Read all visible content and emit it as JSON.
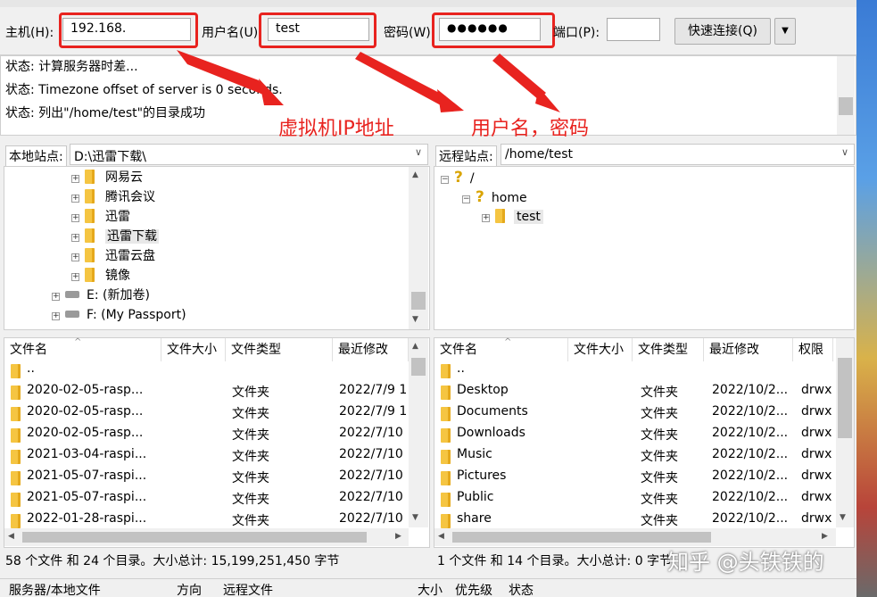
{
  "quickconnect": {
    "host_label": "主机(H):",
    "host_value": "192.168.",
    "user_label": "用户名(U):",
    "user_value": "test",
    "pass_label": "密码(W):",
    "pass_value": "●●●●●●",
    "port_label": "端口(P):",
    "port_value": "",
    "connect_label": "快速连接(Q)"
  },
  "log": [
    "状态: 计算服务器时差...",
    "状态: Timezone offset of server is 0 seconds.",
    "状态: 列出\"/home/test\"的目录成功"
  ],
  "annotations": {
    "vm_ip": "虚拟机IP地址",
    "user_pass": "用户名，密码"
  },
  "local": {
    "site_label": "本地站点:",
    "path": "D:\\迅雷下载\\",
    "tree": [
      "网易云",
      "腾讯会议",
      "迅雷",
      "迅雷下载",
      "迅雷云盘",
      "镜像",
      "E: (新加卷)",
      "F: (My Passport)"
    ],
    "columns": [
      "文件名",
      "文件大小",
      "文件类型",
      "最近修改"
    ],
    "files": [
      {
        "name": "..",
        "type": "",
        "date": ""
      },
      {
        "name": "2020-02-05-rasp...",
        "type": "文件夹",
        "date": "2022/7/9 1"
      },
      {
        "name": "2020-02-05-rasp...",
        "type": "文件夹",
        "date": "2022/7/9 1"
      },
      {
        "name": "2020-02-05-rasp...",
        "type": "文件夹",
        "date": "2022/7/10"
      },
      {
        "name": "2021-03-04-raspi...",
        "type": "文件夹",
        "date": "2022/7/10"
      },
      {
        "name": "2021-05-07-raspi...",
        "type": "文件夹",
        "date": "2022/7/10"
      },
      {
        "name": "2021-05-07-raspi...",
        "type": "文件夹",
        "date": "2022/7/10"
      },
      {
        "name": "2022-01-28-raspi...",
        "type": "文件夹",
        "date": "2022/7/10"
      }
    ],
    "status": "58 个文件 和 24 个目录。大小总计: 15,199,251,450 字节"
  },
  "remote": {
    "site_label": "远程站点:",
    "path": "/home/test",
    "tree": [
      "/",
      "home",
      "test"
    ],
    "columns": [
      "文件名",
      "文件大小",
      "文件类型",
      "最近修改",
      "权限"
    ],
    "files": [
      {
        "name": "..",
        "type": "",
        "date": "",
        "perm": ""
      },
      {
        "name": "Desktop",
        "type": "文件夹",
        "date": "2022/10/2...",
        "perm": "drwx"
      },
      {
        "name": "Documents",
        "type": "文件夹",
        "date": "2022/10/2...",
        "perm": "drwx"
      },
      {
        "name": "Downloads",
        "type": "文件夹",
        "date": "2022/10/2...",
        "perm": "drwx"
      },
      {
        "name": "Music",
        "type": "文件夹",
        "date": "2022/10/2...",
        "perm": "drwx"
      },
      {
        "name": "Pictures",
        "type": "文件夹",
        "date": "2022/10/2...",
        "perm": "drwx"
      },
      {
        "name": "Public",
        "type": "文件夹",
        "date": "2022/10/2...",
        "perm": "drwx"
      },
      {
        "name": "share",
        "type": "文件夹",
        "date": "2022/10/2...",
        "perm": "drwx"
      }
    ],
    "status": "1 个文件 和 14 个目录。大小总计: 0 字节"
  },
  "queue_columns": [
    "服务器/本地文件",
    "方向",
    "远程文件",
    "大小",
    "优先级",
    "状态"
  ],
  "watermark": "知乎 @头铁铁的",
  "colors": {
    "annotation": "#e8231f",
    "folder": "#f5c542"
  }
}
